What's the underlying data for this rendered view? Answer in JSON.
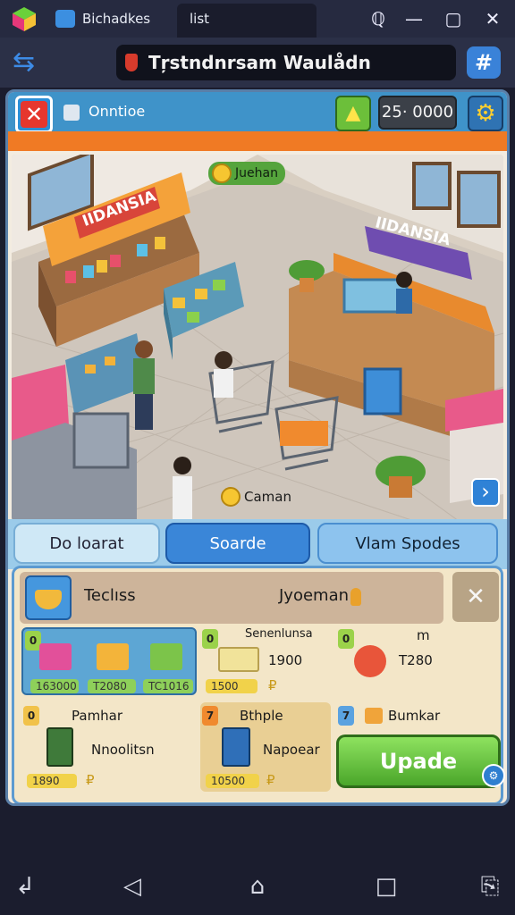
{
  "window": {
    "tab1_title": "Bichadkes",
    "tab2_title": "list",
    "controls": {
      "extension": "ℚ",
      "minimize": "—",
      "maximize": "▢",
      "close": "✕"
    }
  },
  "navbar": {
    "back_icon": "⇆",
    "title": "Tŗstndnrsam Waulådn",
    "grid_icon": "#"
  },
  "hud": {
    "close_icon": "✕",
    "shop_label": "Onntioe",
    "upgrade_icon": "▲",
    "money": "25· 0000",
    "settings_icon": "⚙"
  },
  "scene": {
    "coin_label": "Juehan",
    "sign_left": "IIDANSIA",
    "sign_right": "IIDANSIA",
    "customer_label": "Caman",
    "arrow_icon": "›"
  },
  "tabs": [
    {
      "label": "Do loarat"
    },
    {
      "label": "Soarde"
    },
    {
      "label": "Vlam Spodes"
    }
  ],
  "panel": {
    "head_title": "Teclıss",
    "head_right": "Jyoeman",
    "close_icon": "✕",
    "row1": {
      "card1": {
        "badge": "0",
        "prices": [
          "163000",
          "T2080",
          "TC1016"
        ]
      },
      "card2": {
        "badge": "0",
        "title": "Senenlunsa",
        "value": "1900",
        "bar": "1500",
        "currency": "₽"
      },
      "card3": {
        "badge": "0",
        "title": "m",
        "value": "T280"
      }
    },
    "row2": {
      "card1": {
        "badge": "0",
        "title": "Pamhar",
        "name": "Nnoolitsn",
        "bar": "1890",
        "currency": "₽"
      },
      "card2": {
        "badge": "7",
        "title": "Bthple",
        "name": "Napoear",
        "bar": "10500",
        "currency": "₽"
      },
      "card3": {
        "badge": "7",
        "title": "Bumkar"
      }
    },
    "update_button": "Upade",
    "update_badge": "⚙"
  },
  "sysbar": {
    "back": "↲",
    "home_tri": "◁",
    "home": "⌂",
    "recent": "□",
    "screenshot": "⎘"
  }
}
